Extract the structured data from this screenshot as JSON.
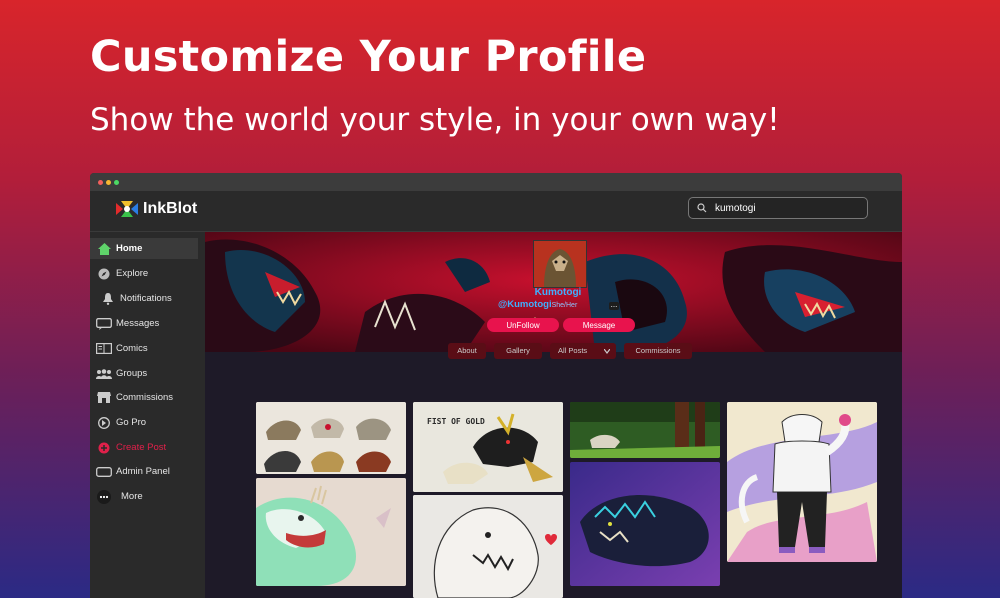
{
  "hero": {
    "title": "Customize Your Profile",
    "subtitle": "Show the world your style, in your own way!"
  },
  "app": {
    "brand": "InkBlot",
    "search": {
      "value": "kumotogi",
      "icon": "search-icon"
    }
  },
  "sidebar": {
    "items": [
      {
        "label": "Home",
        "icon": "home-icon",
        "active": true
      },
      {
        "label": "Explore",
        "icon": "compass-icon"
      },
      {
        "label": "Notifications",
        "icon": "bell-icon"
      },
      {
        "label": "Messages",
        "icon": "chat-icon"
      },
      {
        "label": "Comics",
        "icon": "book-icon"
      },
      {
        "label": "Groups",
        "icon": "group-icon"
      },
      {
        "label": "Commissions",
        "icon": "shop-icon"
      },
      {
        "label": "Go Pro",
        "icon": "pro-icon"
      },
      {
        "label": "Create Post",
        "icon": "plus-circle-icon"
      },
      {
        "label": "Admin Panel",
        "icon": "panel-icon"
      },
      {
        "label": "More",
        "icon": "dots-icon"
      }
    ]
  },
  "profile": {
    "name": "Kumotogi",
    "handle": "@Kumotogi",
    "pronouns": "She/Her",
    "unfollow_label": "UnFollow",
    "message_label": "Message",
    "more_label": "..."
  },
  "tabs": {
    "about": "About",
    "gallery": "Gallery",
    "all_posts": "All Posts",
    "commissions": "Commissions"
  },
  "gallery": {
    "fist_text": "FIST OF GOLD"
  },
  "colors": {
    "accent": "#e8134d",
    "link": "#3fb0ff",
    "window": "#2a2a2a"
  }
}
